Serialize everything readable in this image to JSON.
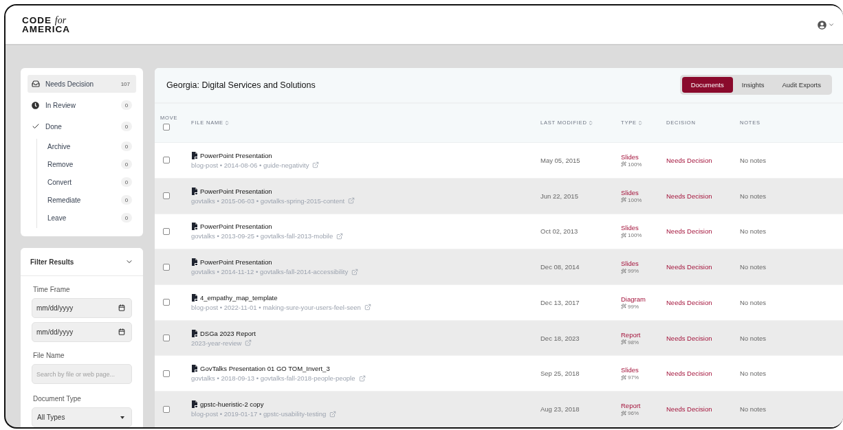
{
  "header": {
    "logo": {
      "word1": "CODE",
      "word2": "for",
      "word3": "AMERICA"
    }
  },
  "sidebar": {
    "status_items": [
      {
        "kind": "inbox",
        "label": "Needs Decision",
        "count": "107",
        "selected": true
      },
      {
        "kind": "clock",
        "label": "In Review",
        "count": "0",
        "selected": false
      },
      {
        "kind": "check",
        "label": "Done",
        "count": "0",
        "selected": false,
        "children": [
          {
            "label": "Archive",
            "count": "0",
            "selected": false
          },
          {
            "label": "Remove",
            "count": "0",
            "selected": false
          },
          {
            "label": "Convert",
            "count": "0",
            "selected": false
          },
          {
            "label": "Remediate",
            "count": "0",
            "selected": false
          },
          {
            "label": "Leave",
            "count": "0",
            "selected": false
          }
        ]
      }
    ],
    "filter": {
      "title": "Filter Results",
      "expanded": true,
      "time_frame": {
        "label": "Time Frame",
        "inputs": [
          {
            "placeholder": "mm/dd/yyyy"
          },
          {
            "placeholder": "mm/dd/yyyy"
          }
        ]
      },
      "file_name": {
        "label": "File Name",
        "placeholder": "Search by file or web page..."
      },
      "document_type": {
        "label": "Document Type",
        "value": "All Types"
      }
    }
  },
  "main": {
    "title": "Georgia: Digital Services and Solutions",
    "tabs": [
      {
        "label": "Documents",
        "selected": true
      },
      {
        "label": "Insights",
        "selected": false
      },
      {
        "label": "Audit Exports",
        "selected": false
      }
    ],
    "table": {
      "columns": [
        {
          "label": "MOVE",
          "kind": "checkbox",
          "checked": false
        },
        {
          "label": "FILE NAME",
          "kind": "sortable"
        },
        {
          "label": "LAST MODIFIED",
          "kind": "sortable"
        },
        {
          "label": "TYPE",
          "kind": "sortable"
        },
        {
          "label": "DECISION",
          "kind": "plain"
        },
        {
          "label": "NOTES",
          "kind": "plain"
        }
      ],
      "rows": [
        {
          "checked": false,
          "file_name": "PowerPoint Presentation",
          "meta": "blog-post • 2014-08-06 • guide-negativity",
          "modified": "May 05, 2015",
          "type": "Slides",
          "confidence": "100%",
          "decision": "Needs Decision",
          "notes": "No notes"
        },
        {
          "checked": false,
          "file_name": "PowerPoint Presentation",
          "meta": "govtalks • 2015-06-03 • govtalks-spring-2015-content",
          "modified": "Jun 22, 2015",
          "type": "Slides",
          "confidence": "100%",
          "decision": "Needs Decision",
          "notes": "No notes"
        },
        {
          "checked": false,
          "file_name": "PowerPoint Presentation",
          "meta": "govtalks • 2013-09-25 • govtalks-fall-2013-mobile",
          "modified": "Oct 02, 2013",
          "type": "Slides",
          "confidence": "100%",
          "decision": "Needs Decision",
          "notes": "No notes"
        },
        {
          "checked": false,
          "file_name": "PowerPoint Presentation",
          "meta": "govtalks • 2014-11-12 • govtalks-fall-2014-accessibility",
          "modified": "Dec 08, 2014",
          "type": "Slides",
          "confidence": "99%",
          "decision": "Needs Decision",
          "notes": "No notes"
        },
        {
          "checked": false,
          "file_name": "4_empathy_map_template",
          "meta": "blog-post • 2022-11-01 • making-sure-your-users-feel-seen",
          "modified": "Dec 13, 2017",
          "type": "Diagram",
          "confidence": "99%",
          "decision": "Needs Decision",
          "notes": "No notes"
        },
        {
          "checked": false,
          "file_name": "DSGa 2023 Report",
          "meta": "2023-year-review",
          "modified": "Dec 18, 2023",
          "type": "Report",
          "confidence": "98%",
          "decision": "Needs Decision",
          "notes": "No notes"
        },
        {
          "checked": false,
          "file_name": "GovTalks Presentation 01 GO TOM_Invert_3",
          "meta": "govtalks • 2018-09-13 • govtalks-fall-2018-people-people",
          "modified": "Sep 25, 2018",
          "type": "Slides",
          "confidence": "97%",
          "decision": "Needs Decision",
          "notes": "No notes"
        },
        {
          "checked": false,
          "file_name": "gpstc-hueristic-2 copy",
          "meta": "blog-post • 2019-01-17 • gpstc-usability-testing",
          "modified": "Aug 23, 2018",
          "type": "Report",
          "confidence": "96%",
          "decision": "Needs Decision",
          "notes": "No notes"
        }
      ]
    }
  }
}
